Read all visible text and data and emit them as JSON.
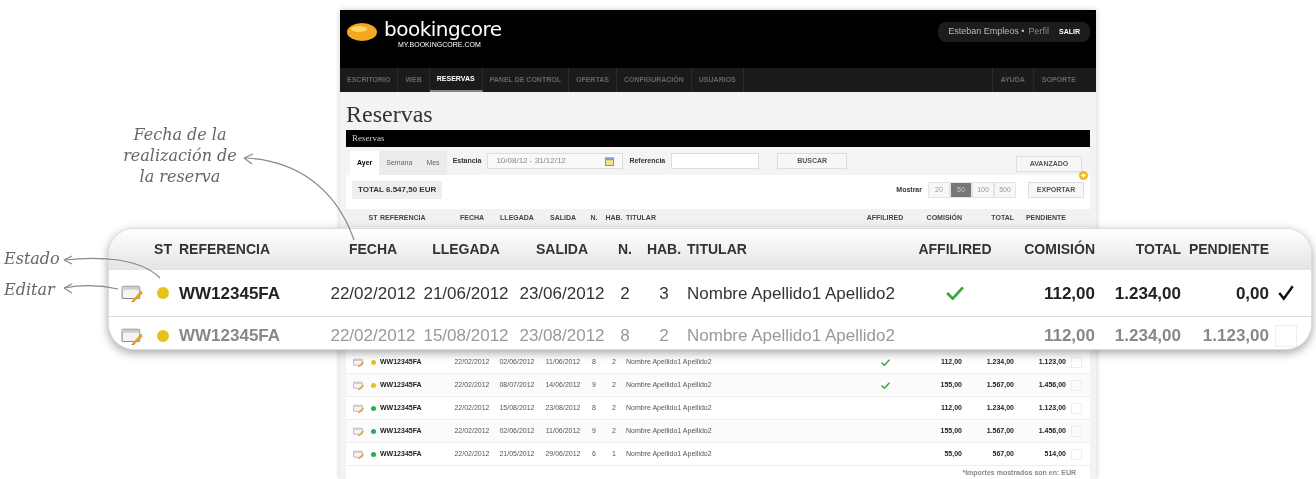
{
  "annotations": [
    {
      "kind": "date",
      "text": "Fecha de la realización de la reserva"
    },
    {
      "kind": "status",
      "text": "Estado"
    },
    {
      "kind": "edit",
      "text": "Editar"
    }
  ],
  "header": {
    "logo": "bookingcore",
    "logo_sub": "MY.BOOKINGCORE.COM",
    "user": "Esteban Empleos •",
    "profile_link": "Perfil",
    "logout": "SALIR"
  },
  "nav": {
    "left": [
      {
        "label": "ESCRITORIO",
        "selected": false
      },
      {
        "label": "WEB",
        "selected": false
      },
      {
        "label": "RESERVAS",
        "selected": true
      },
      {
        "label": "PANEL DE CONTROL",
        "selected": false
      },
      {
        "label": "OFERTAS",
        "selected": false
      },
      {
        "label": "CONFIGURACIÓN",
        "selected": false
      },
      {
        "label": "USUARIOS",
        "selected": false
      }
    ],
    "right": [
      "AYUDA",
      "SOPORTE"
    ]
  },
  "page_title": "Reservas",
  "panel": {
    "title": "Reservas",
    "period_tabs": [
      {
        "label": "Ayer",
        "selected": true
      },
      {
        "label": "Semana",
        "selected": false
      },
      {
        "label": "Mes",
        "selected": false
      }
    ],
    "stay_label": "Estancia",
    "stay_value": "10/08/12 - 31/12/12",
    "reference_label": "Referencia",
    "search_button": "BUSCAR",
    "advanced_button": "AVANZADO",
    "total": "TOTAL 6.547,50 EUR",
    "show_label": "Mostrar",
    "page_sizes": [
      {
        "label": "20",
        "selected": false
      },
      {
        "label": "50",
        "selected": true
      },
      {
        "label": "100",
        "selected": false
      },
      {
        "label": "500",
        "selected": false
      }
    ],
    "export_button": "EXPORTAR"
  },
  "table": {
    "columns": [
      "ST",
      "REFERENCIA",
      "FECHA",
      "LLEGADA",
      "SALIDA",
      "N.",
      "HAB.",
      "TITULAR",
      "AFFILIRED",
      "COMISIÓN",
      "TOTAL",
      "PENDIENTE"
    ],
    "rows": [
      {
        "color": "#e8c21a",
        "reference": "WW12345FA",
        "date": "22/02/2012",
        "arrival": "02/06/2012",
        "departure": "11/06/2012",
        "n": "8",
        "rooms": "2",
        "holder": "Nombre Apellido1 Apellido2",
        "affiliated": true,
        "commission": "112,00",
        "total": "1.234,00",
        "pending": "1.123,00",
        "checked": false
      },
      {
        "color": "#e8c21a",
        "reference": "WW12345FA",
        "date": "22/02/2012",
        "arrival": "08/07/2012",
        "departure": "14/06/2012",
        "n": "9",
        "rooms": "2",
        "holder": "Nombre Apellido1 Apellido2",
        "affiliated": true,
        "commission": "155,00",
        "total": "1.567,00",
        "pending": "1.456,00",
        "checked": false
      },
      {
        "color": "#22b14c",
        "reference": "WW12345FA",
        "date": "22/02/2012",
        "arrival": "15/08/2012",
        "departure": "23/08/2012",
        "n": "8",
        "rooms": "2",
        "holder": "Nombre Apellido1 Apellido2",
        "affiliated": false,
        "commission": "112,00",
        "total": "1.234,00",
        "pending": "1.123,00",
        "checked": false
      },
      {
        "color": "#22b14c",
        "reference": "WW12345FA",
        "date": "22/02/2012",
        "arrival": "02/06/2012",
        "departure": "11/06/2012",
        "n": "9",
        "rooms": "2",
        "holder": "Nombre Apellido1 Apellido2",
        "affiliated": false,
        "commission": "155,00",
        "total": "1.567,00",
        "pending": "1.456,00",
        "checked": false
      },
      {
        "color": "#22b14c",
        "reference": "WW12345FA",
        "date": "22/02/2012",
        "arrival": "21/05/2012",
        "departure": "29/06/2012",
        "n": "6",
        "rooms": "1",
        "holder": "Nombre Apellido1 Apellido2",
        "affiliated": false,
        "commission": "55,00",
        "total": "567,00",
        "pending": "514,00",
        "checked": false
      }
    ],
    "footnote": "*Importes mostrados son en: EUR"
  },
  "magnifier": {
    "columns": [
      "ST",
      "REFERENCIA",
      "FECHA",
      "LLEGADA",
      "SALIDA",
      "N.",
      "HAB.",
      "TITULAR",
      "AFFILIRED",
      "COMISIÓN",
      "TOTAL",
      "PENDIENTE"
    ],
    "rows": [
      {
        "color": "#e8c21a",
        "reference": "WW12345FA",
        "date": "22/02/2012",
        "arrival": "21/06/2012",
        "departure": "23/06/2012",
        "n": "2",
        "rooms": "3",
        "holder": "Nombre Apellido1 Apellido2",
        "affiliated": true,
        "commission": "112,00",
        "total": "1.234,00",
        "pending": "0,00",
        "checked": true
      },
      {
        "color": "#e8c21a",
        "reference": "WW12345FA",
        "date": "22/02/2012",
        "arrival": "15/08/2012",
        "departure": "23/08/2012",
        "n": "8",
        "rooms": "2",
        "holder": "Nombre Apellido1 Apellido2",
        "affiliated": false,
        "commission": "112,00",
        "total": "1.234,00",
        "pending": "1.123,00",
        "checked": false
      }
    ]
  }
}
